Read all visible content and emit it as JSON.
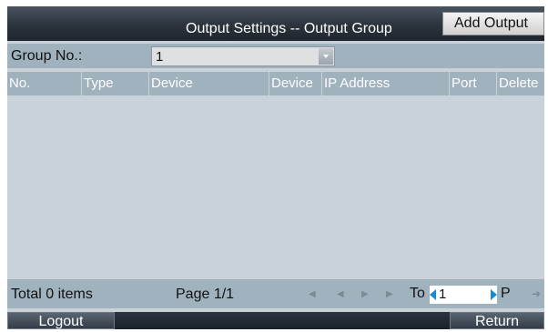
{
  "header": {
    "title": "Output Settings -- Output Group",
    "add_button": "Add Output"
  },
  "group": {
    "label": "Group No.:",
    "value": "1"
  },
  "table": {
    "columns": [
      "No.",
      "Type",
      "Device",
      "Device",
      "IP Address",
      "Port",
      "Delete"
    ],
    "rows": []
  },
  "footer": {
    "total": "Total 0 items",
    "page": "Page 1/1",
    "to_label": "To",
    "to_value": "1",
    "page_suffix": "P"
  },
  "bottom": {
    "logout": "Logout",
    "return": "Return"
  },
  "icons": {
    "first": "first-page-icon",
    "prev": "prev-page-icon",
    "next": "next-page-icon",
    "last": "last-page-icon",
    "go": "go-arrow-icon",
    "dropdown": "chevron-down-icon"
  },
  "colors": {
    "panel": "#c8d2d8",
    "header": "#9fb2be",
    "titlebar": "#2b333c",
    "accent": "#1a8ad4"
  }
}
